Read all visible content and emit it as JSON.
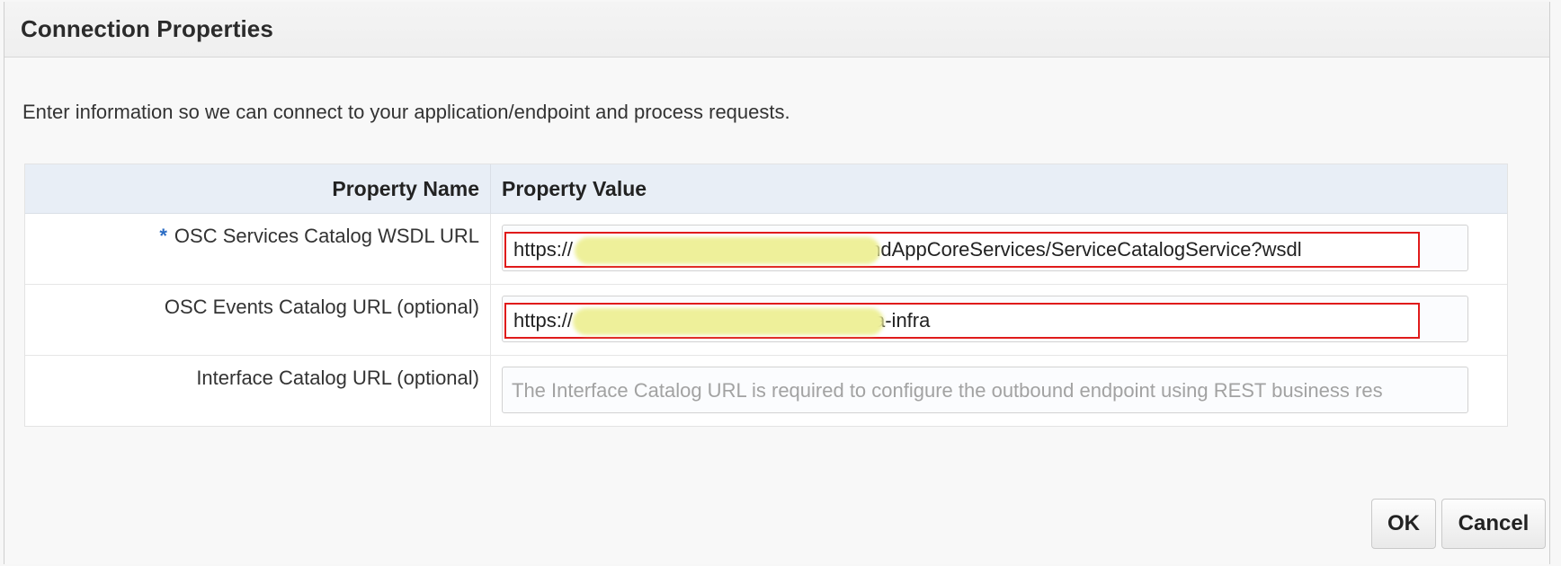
{
  "dialog": {
    "title": "Connection Properties",
    "intro": "Enter information so we can connect to your application/endpoint and process requests."
  },
  "table": {
    "headers": {
      "name": "Property Name",
      "value": "Property Value"
    },
    "rows": [
      {
        "required_marker": "*",
        "label": "OSC Services Catalog WSDL URL",
        "value": "https://                                                  n/fndAppCoreServices/ServiceCatalogService?wsdl",
        "placeholder": ""
      },
      {
        "required_marker": "",
        "label": "OSC Events Catalog URL (optional)",
        "value": "https://                                                  /soa-infra",
        "placeholder": ""
      },
      {
        "required_marker": "",
        "label": "Interface Catalog URL (optional)",
        "value": "",
        "placeholder": "The Interface Catalog URL is required to configure the outbound endpoint using REST business res"
      }
    ]
  },
  "buttons": {
    "ok": "OK",
    "cancel": "Cancel"
  },
  "colors": {
    "header_bg": "#efefef",
    "table_header_bg": "#e8eef6",
    "required_marker": "#2b6cc4",
    "highlight_border": "#e01b1b",
    "redaction": "#eef09a"
  }
}
